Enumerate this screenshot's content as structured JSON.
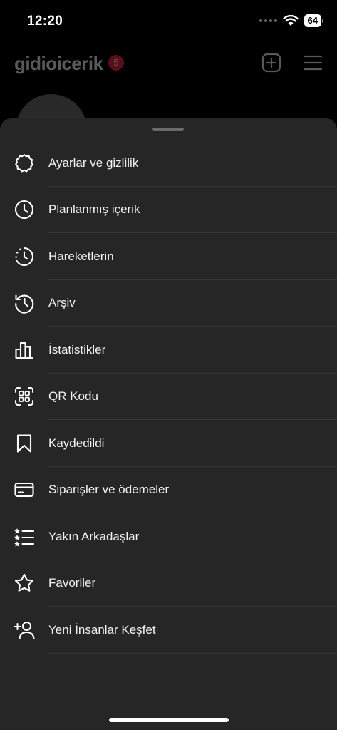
{
  "status_bar": {
    "time": "12:20",
    "battery": "64"
  },
  "header": {
    "username": "gidioicerik",
    "notification_count": "5",
    "icons": [
      "plus-square-icon",
      "hamburger-menu-icon"
    ]
  },
  "menu": {
    "items": [
      {
        "label": "Ayarlar ve gizlilik",
        "icon": "gear-icon"
      },
      {
        "label": "Planlanmış içerik",
        "icon": "clock-icon"
      },
      {
        "label": "Hareketlerin",
        "icon": "activity-clock-icon"
      },
      {
        "label": "Arşiv",
        "icon": "history-icon"
      },
      {
        "label": "İstatistikler",
        "icon": "bar-chart-icon"
      },
      {
        "label": "QR Kodu",
        "icon": "qr-scan-icon"
      },
      {
        "label": "Kaydedildi",
        "icon": "bookmark-icon"
      },
      {
        "label": "Siparişler ve ödemeler",
        "icon": "credit-card-icon"
      },
      {
        "label": "Yakın Arkadaşlar",
        "icon": "star-list-icon"
      },
      {
        "label": "Favoriler",
        "icon": "star-icon"
      },
      {
        "label": "Yeni İnsanlar Keşfet",
        "icon": "add-person-icon"
      }
    ]
  },
  "colors": {
    "sheet_background": "#262626",
    "page_background": "#000000",
    "divider": "#363636",
    "badge": "#ff2a4a"
  }
}
